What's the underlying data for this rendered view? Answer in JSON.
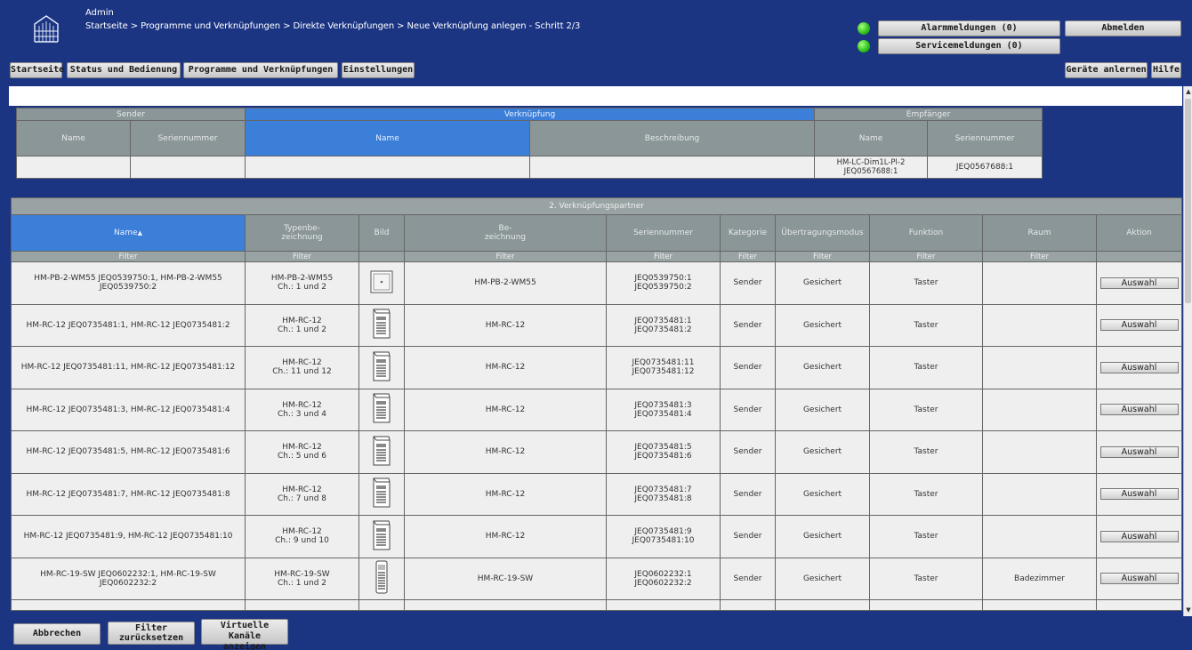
{
  "header": {
    "user": "Admin",
    "breadcrumb": "Startseite > Programme und Verknüpfungen > Direkte Verknüpfungen > Neue Verknüpfung anlegen - Schritt 2/3",
    "nav": [
      "Startseite",
      "Status und Bedienung",
      "Programme und Verknüpfungen",
      "Einstellungen"
    ],
    "alarm": "Alarmmeldungen (0)",
    "service": "Servicemeldungen (0)",
    "logout": "Abmelden",
    "teach": "Geräte anlernen",
    "help": "Hilfe",
    "led_color": "#2bbf1b"
  },
  "link": {
    "groups": {
      "sender": "Sender",
      "verknuepfung": "Verknüpfung",
      "empfaenger": "Empfänger"
    },
    "cols": {
      "sender_name": "Name",
      "sender_serial": "Seriennummer",
      "link_name": "Name",
      "link_desc": "Beschreibung",
      "recv_name": "Name",
      "recv_serial": "Seriennummer"
    },
    "row": {
      "sender_name": "",
      "sender_serial": "",
      "link_name": "",
      "link_desc": "",
      "recv_name": "HM-LC-Dim1L-Pl-2 JEQ0567688:1",
      "recv_serial": "JEQ0567688:1"
    }
  },
  "partner": {
    "title": "2. Verknüpfungspartner",
    "cols": {
      "name": "Name",
      "sort_icon": "arrow-up-icon",
      "type": "Typenbe-\nzeichnung",
      "bild": "Bild",
      "bez": "Be-\nzeichnung",
      "serial": "Seriennummer",
      "kategorie": "Kategorie",
      "modus": "Übertragungsmodus",
      "funktion": "Funktion",
      "raum": "Raum",
      "aktion": "Aktion"
    },
    "filter": "Filter",
    "action_label": "Auswahl",
    "rows": [
      {
        "name": "HM-PB-2-WM55 JEQ0539750:1, HM-PB-2-WM55 JEQ0539750:2",
        "type": "HM-PB-2-WM55\nCh.: 1 und 2",
        "icon": "wall-button-icon",
        "bez": "HM-PB-2-WM55",
        "serial": "JEQ0539750:1\nJEQ0539750:2",
        "kategorie": "Sender",
        "modus": "Gesichert",
        "funktion": "Taster",
        "raum": ""
      },
      {
        "name": "HM-RC-12 JEQ0735481:1, HM-RC-12 JEQ0735481:2",
        "type": "HM-RC-12\nCh.: 1 und 2",
        "icon": "remote-control-icon",
        "bez": "HM-RC-12",
        "serial": "JEQ0735481:1\nJEQ0735481:2",
        "kategorie": "Sender",
        "modus": "Gesichert",
        "funktion": "Taster",
        "raum": ""
      },
      {
        "name": "HM-RC-12 JEQ0735481:11, HM-RC-12 JEQ0735481:12",
        "type": "HM-RC-12\nCh.: 11 und 12",
        "icon": "remote-control-icon",
        "bez": "HM-RC-12",
        "serial": "JEQ0735481:11\nJEQ0735481:12",
        "kategorie": "Sender",
        "modus": "Gesichert",
        "funktion": "Taster",
        "raum": ""
      },
      {
        "name": "HM-RC-12 JEQ0735481:3, HM-RC-12 JEQ0735481:4",
        "type": "HM-RC-12\nCh.: 3 und 4",
        "icon": "remote-control-icon",
        "bez": "HM-RC-12",
        "serial": "JEQ0735481:3\nJEQ0735481:4",
        "kategorie": "Sender",
        "modus": "Gesichert",
        "funktion": "Taster",
        "raum": ""
      },
      {
        "name": "HM-RC-12 JEQ0735481:5, HM-RC-12 JEQ0735481:6",
        "type": "HM-RC-12\nCh.: 5 und 6",
        "icon": "remote-control-icon",
        "bez": "HM-RC-12",
        "serial": "JEQ0735481:5\nJEQ0735481:6",
        "kategorie": "Sender",
        "modus": "Gesichert",
        "funktion": "Taster",
        "raum": ""
      },
      {
        "name": "HM-RC-12 JEQ0735481:7, HM-RC-12 JEQ0735481:8",
        "type": "HM-RC-12\nCh.: 7 und 8",
        "icon": "remote-control-icon",
        "bez": "HM-RC-12",
        "serial": "JEQ0735481:7\nJEQ0735481:8",
        "kategorie": "Sender",
        "modus": "Gesichert",
        "funktion": "Taster",
        "raum": ""
      },
      {
        "name": "HM-RC-12 JEQ0735481:9, HM-RC-12 JEQ0735481:10",
        "type": "HM-RC-12\nCh.: 9 und 10",
        "icon": "remote-control-icon",
        "bez": "HM-RC-12",
        "serial": "JEQ0735481:9\nJEQ0735481:10",
        "kategorie": "Sender",
        "modus": "Gesichert",
        "funktion": "Taster",
        "raum": ""
      },
      {
        "name": "HM-RC-19-SW JEQ0602232:1, HM-RC-19-SW JEQ0602232:2",
        "type": "HM-RC-19-SW\nCh.: 1 und 2",
        "icon": "remote-control-19-icon",
        "bez": "HM-RC-19-SW",
        "serial": "JEQ0602232:1\nJEQ0602232:2",
        "kategorie": "Sender",
        "modus": "Gesichert",
        "funktion": "Taster",
        "raum": "Badezimmer"
      }
    ]
  },
  "footer": {
    "cancel": "Abbrechen",
    "reset": "Filter\nzurücksetzen",
    "virtual": "Virtuelle Kanäle\nanzeigen"
  }
}
